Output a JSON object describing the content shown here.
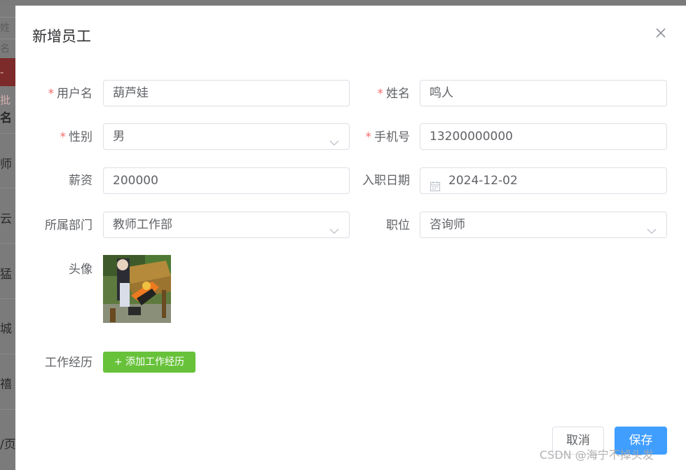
{
  "background": {
    "search_fragment": "姓名",
    "button_fragment": "- 批",
    "column_fragment": "名",
    "row_fragments": [
      "师",
      "云",
      "猛",
      "城",
      "禧"
    ],
    "pager_fragment": "/页"
  },
  "dialog": {
    "title": "新增员工",
    "close_icon": "close-icon"
  },
  "form": {
    "required_mark": "*",
    "username": {
      "label": "用户名",
      "value": "葫芦娃",
      "required": true
    },
    "name": {
      "label": "姓名",
      "value": "鸣人",
      "required": true
    },
    "gender": {
      "label": "性别",
      "value": "男",
      "required": true
    },
    "phone": {
      "label": "手机号",
      "value": "13200000000",
      "required": true
    },
    "salary": {
      "label": "薪资",
      "value": "200000"
    },
    "entry_date": {
      "label": "入职日期",
      "value": "2024-12-02"
    },
    "department": {
      "label": "所属部门",
      "value": "教师工作部"
    },
    "position": {
      "label": "职位",
      "value": "咨询师"
    },
    "avatar": {
      "label": "头像"
    },
    "work_experience": {
      "label": "工作经历",
      "add_button": "+ 添加工作经历"
    }
  },
  "footer": {
    "cancel": "取消",
    "save": "保存"
  },
  "watermark": "CSDN @海宁不掉头发",
  "colors": {
    "required": "#f56c6c",
    "primary": "#409eff",
    "success": "#67c23a",
    "border": "#dcdfe6",
    "text": "#606266"
  }
}
